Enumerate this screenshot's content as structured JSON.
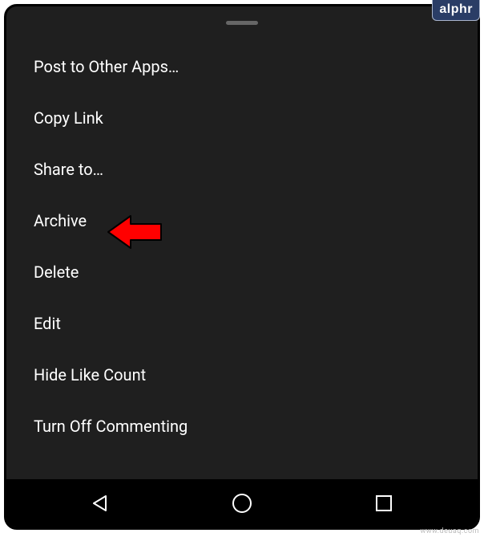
{
  "menu": {
    "items": [
      {
        "label": "Post to Other Apps…"
      },
      {
        "label": "Copy Link"
      },
      {
        "label": "Share to…"
      },
      {
        "label": "Archive"
      },
      {
        "label": "Delete"
      },
      {
        "label": "Edit"
      },
      {
        "label": "Hide Like Count"
      },
      {
        "label": "Turn Off Commenting"
      }
    ]
  },
  "annotation": {
    "arrow_color": "#ff0000",
    "target_index": 3
  },
  "badge": {
    "text": "alphr"
  },
  "watermark": {
    "text": "www.deuaq.com"
  }
}
